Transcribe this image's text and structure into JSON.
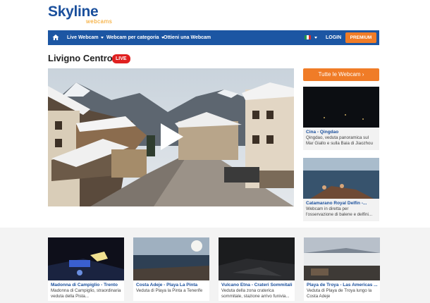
{
  "logo": {
    "main": "Skyline",
    "sub": "webcams"
  },
  "nav": {
    "items": [
      {
        "label": "Live Webcam",
        "dropdown": true
      },
      {
        "label": "Webcam per categoria",
        "dropdown": true
      },
      {
        "label": "Ottieni una Webcam",
        "dropdown": false
      }
    ],
    "login": "LOGIN",
    "premium": "PREMIUM",
    "language_flag": "it-flag"
  },
  "main": {
    "title": "Livigno Centro",
    "live_badge": "LIVE",
    "player_state": "paused"
  },
  "sidebar": {
    "cta": "Tutte le Webcam ›",
    "cards": [
      {
        "title": "Cina - Qingdao",
        "desc": "Qingdao, veduta panoramica sul Mar Giallo e sulla Baia di Jiaozhou"
      },
      {
        "title": "Catamarano Royal Delfin -...",
        "desc": "Webcam in diretta per l'osservazione di balene e delfini..."
      }
    ]
  },
  "bottom": {
    "cards": [
      {
        "title": "Madonna di Campiglio - Trento",
        "desc": "Madonna di Campiglio, straordinaria veduta della Pista..."
      },
      {
        "title": "Costa Adeje - Playa La Pinta",
        "desc": "Veduta di Playa la Pinta a Tenerife"
      },
      {
        "title": "Vulcano Etna - Crateri Sommitali",
        "desc": "Veduta della zona craterica sommitale, stazione arrivo funivia..."
      },
      {
        "title": "Playa de Troya - Las Americas ...",
        "desc": "Veduta di Playa de Troya lungo la Costa Adeje"
      }
    ]
  },
  "colors": {
    "brand_blue": "#1c56a3",
    "accent_orange": "#f07c27",
    "live_red": "#e02020"
  }
}
